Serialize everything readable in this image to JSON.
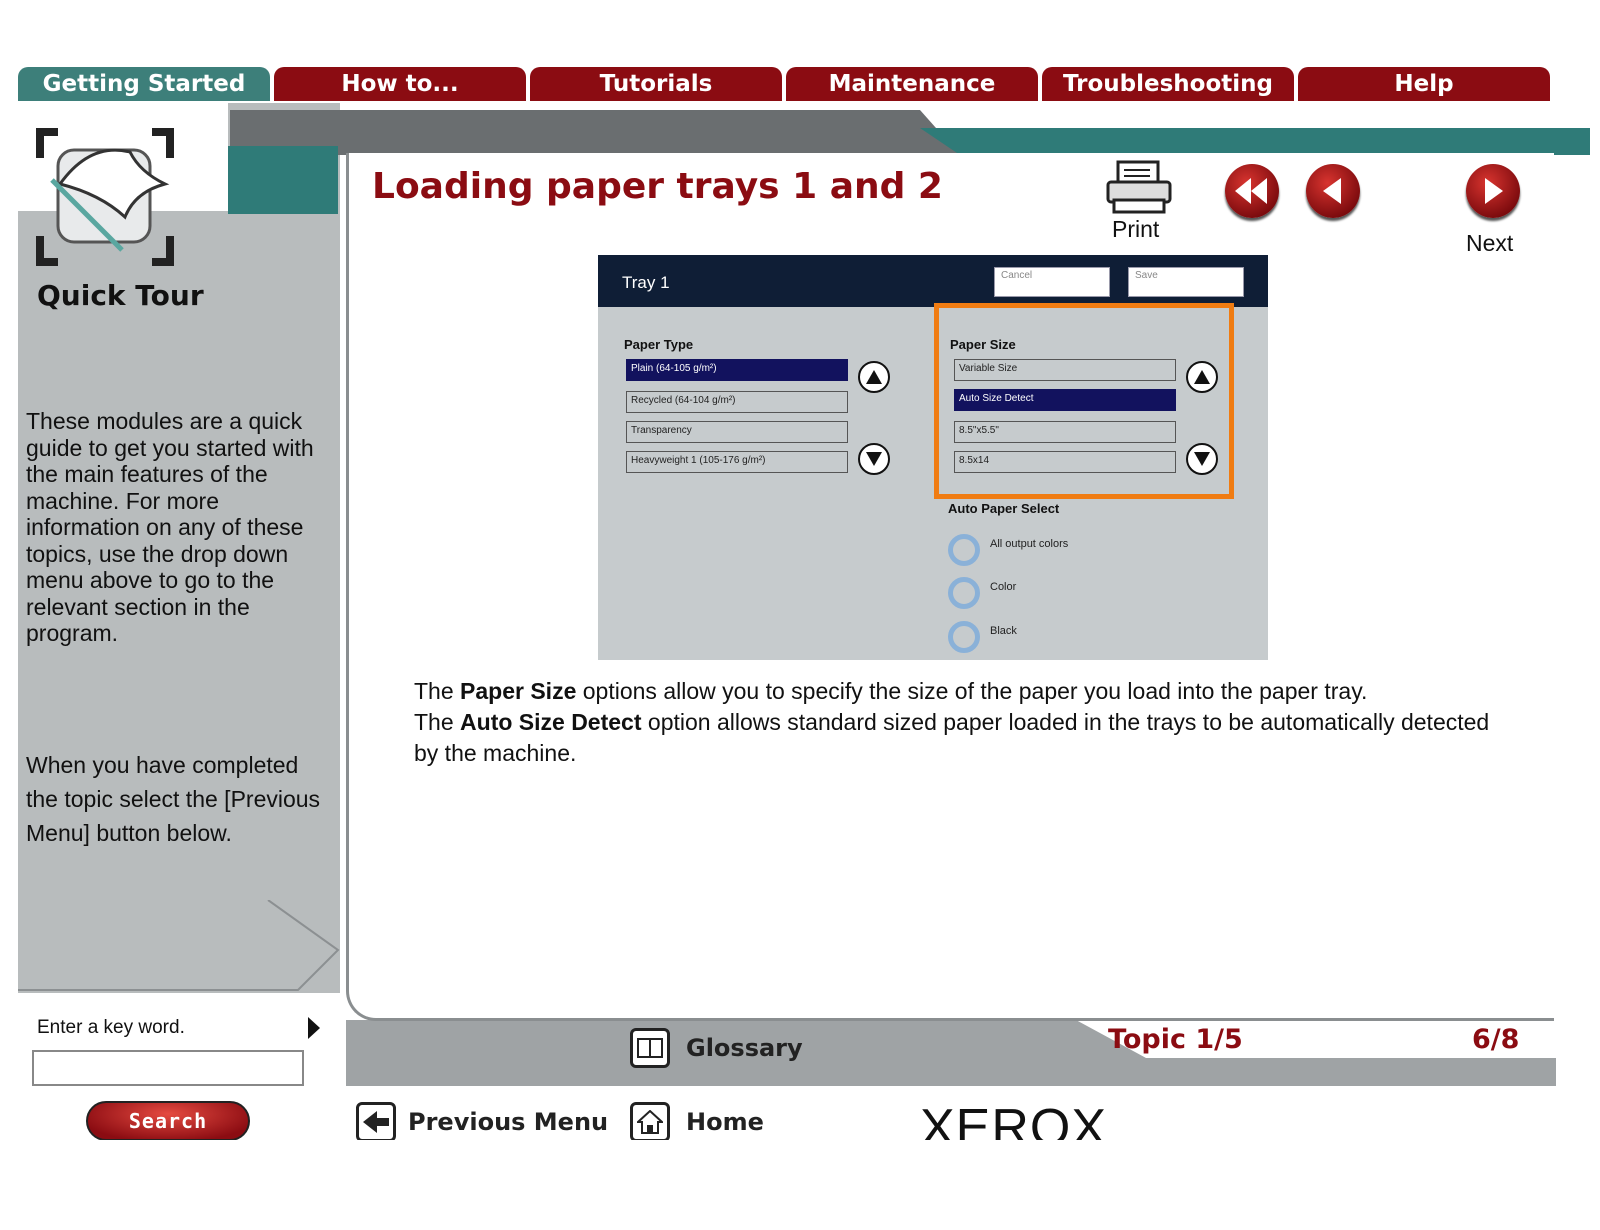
{
  "tabs": [
    "Getting Started",
    "How to...",
    "Tutorials",
    "Maintenance",
    "Troubleshooting",
    "Help"
  ],
  "sidebar": {
    "section_title": "Quick Tour",
    "intro_text": "These modules are a quick guide to get you started with the main features of the machine. For more information on any of these topics, use the drop down menu above to go to the relevant section in the program.",
    "completed_text": "When you have completed the topic select the [Previous Menu] button below.",
    "search_label": "Enter a key word.",
    "search_value": "",
    "search_button": "Search"
  },
  "main": {
    "title": "Loading paper trays 1 and 2",
    "print_label": "Print",
    "next_label": "Next",
    "description": {
      "line1_pre": "The ",
      "line1_bold": "Paper Size",
      "line1_post": " options allow you to specify the size of the paper you load into the paper tray.",
      "line2_pre": "The ",
      "line2_bold": "Auto Size Detect",
      "line2_post": " option allows standard sized paper loaded in the trays to be automatically detected by the machine."
    }
  },
  "tray_screen": {
    "title": "Tray 1",
    "cancel": "Cancel",
    "save": "Save",
    "paper_type_label": "Paper Type",
    "paper_types": [
      "Plain (64-105 g/m²)",
      "Recycled (64-104 g/m²)",
      "Transparency",
      "Heavyweight 1 (105-176 g/m²)"
    ],
    "paper_size_label": "Paper Size",
    "paper_sizes": [
      "Variable Size",
      "Auto Size Detect",
      "8.5\"x5.5\"",
      "8.5x14"
    ],
    "auto_paper_label": "Auto Paper Select",
    "auto_options": [
      "All output colors",
      "Color",
      "Black"
    ]
  },
  "footer": {
    "glossary": "Glossary",
    "previous_menu": "Previous Menu",
    "home": "Home",
    "topic": "Topic 1/5",
    "page": "6/8",
    "brand": "XEROX"
  },
  "colors": {
    "brand_red": "#8b0c12",
    "teal": "#2f7b78",
    "highlight_orange": "#f07c12",
    "selected_navy": "#12125e"
  }
}
